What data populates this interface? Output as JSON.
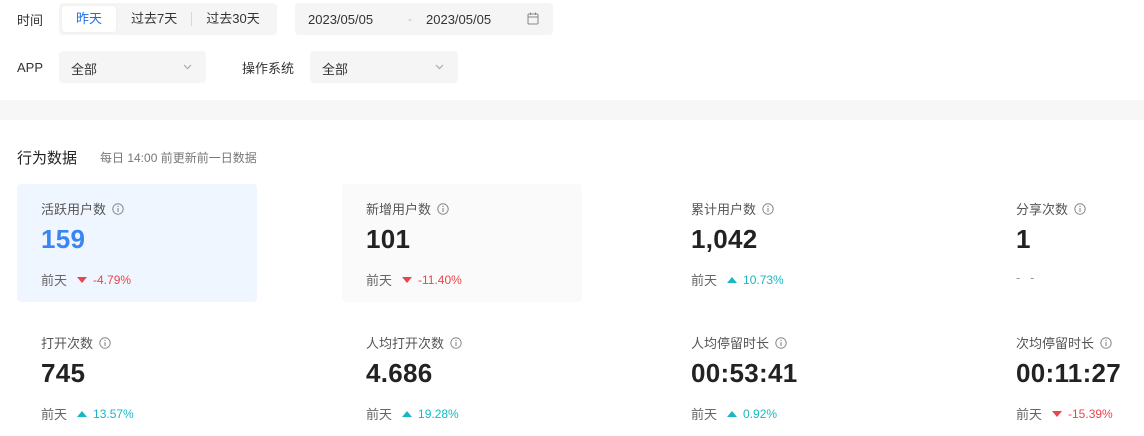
{
  "filters": {
    "time_label": "时间",
    "time_tabs": [
      {
        "label": "昨天",
        "active": true
      },
      {
        "label": "过去7天",
        "active": false
      },
      {
        "label": "过去30天",
        "active": false
      }
    ],
    "date_start": "2023/05/05",
    "date_sep": "-",
    "date_end": "2023/05/05",
    "app_label": "APP",
    "app_value": "全部",
    "os_label": "操作系统",
    "os_value": "全部"
  },
  "section": {
    "title": "行为数据",
    "subtitle": "每日 14:00 前更新前一日数据"
  },
  "colors": {
    "accent": "#3a86f0",
    "up": "#16b8c3",
    "down": "#e8464a"
  },
  "metrics": [
    {
      "name": "活跃用户数",
      "value": "159",
      "cmp_label": "前天",
      "dir": "down",
      "change": "-4.79%"
    },
    {
      "name": "新增用户数",
      "value": "101",
      "cmp_label": "前天",
      "dir": "down",
      "change": "-11.40%"
    },
    {
      "name": "累计用户数",
      "value": "1,042",
      "cmp_label": "前天",
      "dir": "up",
      "change": "10.73%"
    },
    {
      "name": "分享次数",
      "value": "1",
      "cmp_label": "",
      "dir": "none",
      "change": "- -"
    },
    {
      "name": "打开次数",
      "value": "745",
      "cmp_label": "前天",
      "dir": "up",
      "change": "13.57%"
    },
    {
      "name": "人均打开次数",
      "value": "4.686",
      "cmp_label": "前天",
      "dir": "up",
      "change": "19.28%"
    },
    {
      "name": "人均停留时长",
      "value": "00:53:41",
      "cmp_label": "前天",
      "dir": "up",
      "change": "0.92%"
    },
    {
      "name": "次均停留时长",
      "value": "00:11:27",
      "cmp_label": "前天",
      "dir": "down",
      "change": "-15.39%"
    }
  ]
}
